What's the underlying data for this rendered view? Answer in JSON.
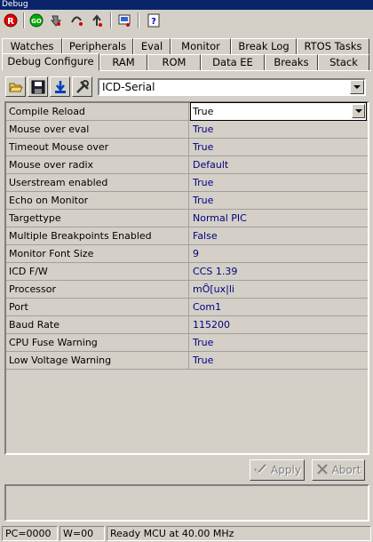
{
  "window": {
    "title": "Debug"
  },
  "toolbar": {
    "buttons": [
      {
        "icon": "reset-icon",
        "label": "R"
      },
      {
        "icon": "go-icon",
        "label": "GO"
      },
      {
        "icon": "step-into-icon"
      },
      {
        "icon": "step-over-icon"
      },
      {
        "icon": "step-out-icon"
      },
      {
        "icon": "snapshot-icon"
      },
      {
        "icon": "help-icon",
        "label": "?"
      }
    ]
  },
  "tabs": {
    "row1": [
      "Watches",
      "Peripherals",
      "Eval",
      "Monitor",
      "Break Log",
      "RTOS Tasks"
    ],
    "row2": [
      "Debug Configure",
      "RAM",
      "ROM",
      "Data EE",
      "Breaks",
      "Stack"
    ],
    "active": "Debug Configure"
  },
  "config_toolbar": {
    "buttons": [
      "open-folder-icon",
      "save-disk-icon",
      "download-icon",
      "tools-icon"
    ],
    "combo_value": "ICD-Serial"
  },
  "properties": [
    {
      "name": "Compile Reload",
      "value": "True"
    },
    {
      "name": "Mouse over eval",
      "value": "True"
    },
    {
      "name": "Timeout Mouse over",
      "value": "True"
    },
    {
      "name": "Mouse over radix",
      "value": "Default"
    },
    {
      "name": "Userstream enabled",
      "value": "True"
    },
    {
      "name": "Echo on Monitor",
      "value": "True"
    },
    {
      "name": "Targettype",
      "value": "Normal PIC"
    },
    {
      "name": "Multiple Breakpoints Enabled",
      "value": "False"
    },
    {
      "name": "Monitor Font Size",
      "value": "9"
    },
    {
      "name": "ICD F/W",
      "value": "CCS 1.39"
    },
    {
      "name": "Processor",
      "value": "mÕ[ux|li"
    },
    {
      "name": "Port",
      "value": "Com1"
    },
    {
      "name": "Baud Rate",
      "value": "115200"
    },
    {
      "name": "CPU Fuse Warning",
      "value": "True"
    },
    {
      "name": "Low Voltage Warning",
      "value": "True"
    }
  ],
  "actions": {
    "apply_label": "Apply",
    "abort_label": "Abort"
  },
  "status": {
    "pc": "PC=0000",
    "w": "W=00",
    "message": "Ready MCU at 40.00 MHz"
  },
  "colors": {
    "title_bg": "#0a246a",
    "value_text": "#000080",
    "face": "#d4d0c8"
  }
}
